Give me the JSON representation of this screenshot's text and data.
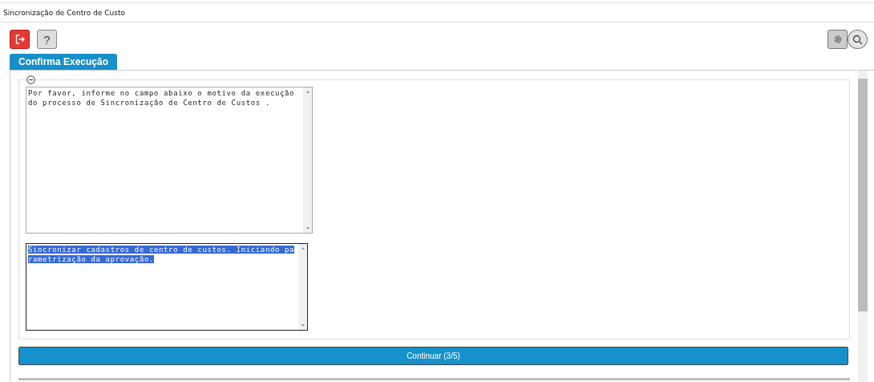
{
  "window": {
    "title": "Sincronização de Centro de Custo"
  },
  "toolbar": {
    "left": [
      {
        "kind": "exit"
      },
      {
        "kind": "help",
        "label": "?"
      }
    ],
    "right": [
      {
        "kind": "settings"
      },
      {
        "kind": "search"
      }
    ]
  },
  "tabs": [
    {
      "label": "Confirma Execução",
      "selected": true
    }
  ],
  "section": {
    "expanded": true,
    "fields": [
      {
        "value": "Por favor, informe no campo abaixo o motivo da execução do processo de Sincronização de Centro de Custos .",
        "focused": false,
        "text_selected": false
      },
      {
        "value": "Sincronizar cadastros de centro de custos. Iniciando parametrização da aprovação.",
        "focused": true,
        "text_selected": true
      }
    ]
  },
  "continue_button": {
    "label": "Continuar (3/5)"
  }
}
